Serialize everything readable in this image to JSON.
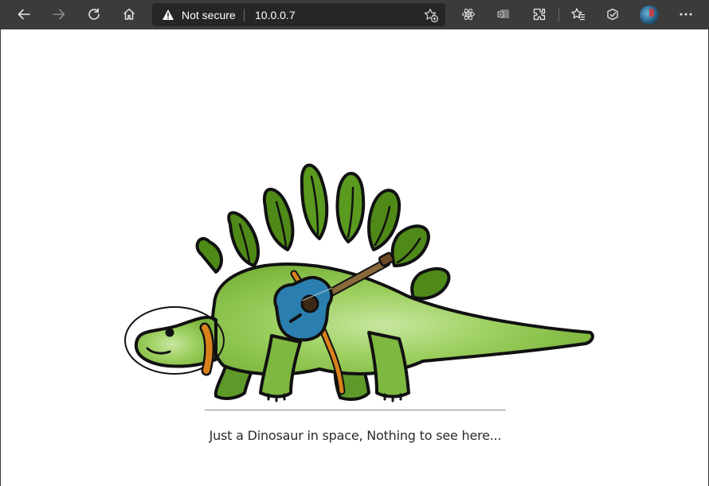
{
  "browser": {
    "security_label": "Not secure",
    "url": "10.0.0.7",
    "icons": [
      "back-icon",
      "forward-icon",
      "refresh-icon",
      "home-icon",
      "warning-icon",
      "add-favorite-icon",
      "react-devtools-icon",
      "outlook-icon",
      "extensions-icon",
      "favorites-icon",
      "collections-icon",
      "profile-avatar",
      "more-icon"
    ]
  },
  "page": {
    "illustration": "stegosaurus-astronaut-with-guitar",
    "caption": "Just a Dinosaur in space, Nothing to see here..."
  },
  "colors": {
    "toolbar": "#3b3b3b",
    "address_bar": "#262626",
    "dino_body": "#8cc54a",
    "dino_plates": "#4f8a18",
    "guitar": "#2b7fb0",
    "strap": "#d9821c"
  }
}
